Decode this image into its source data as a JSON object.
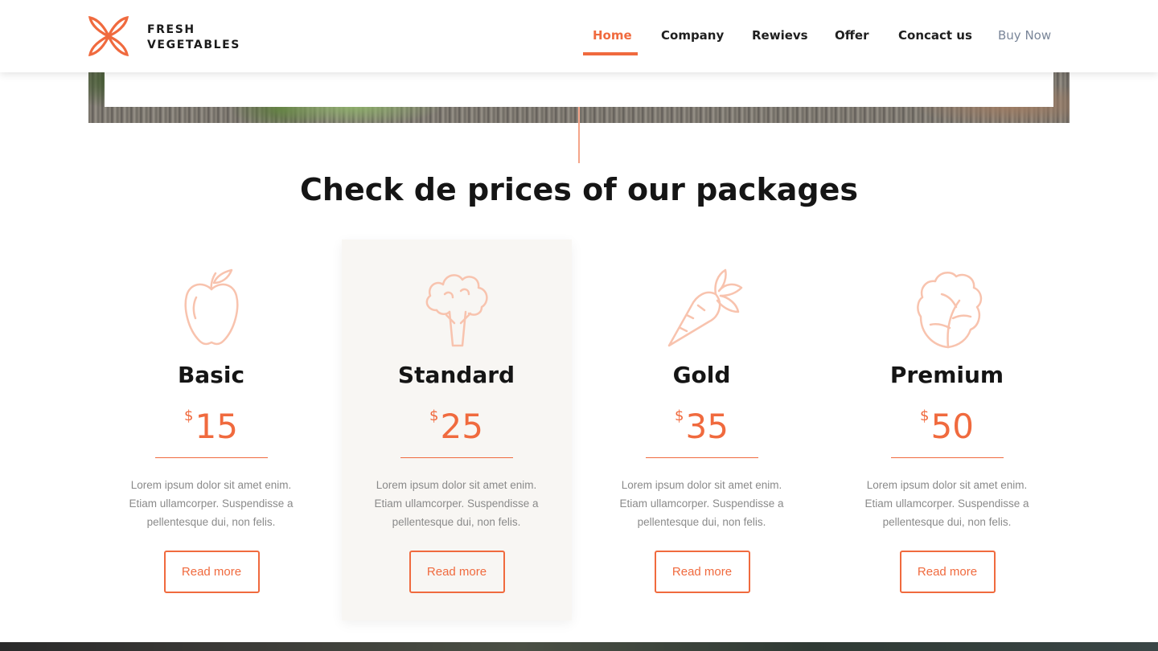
{
  "brand": {
    "line1": "FRESH",
    "line2": "VEGETABLES"
  },
  "nav": [
    {
      "label": "Home",
      "active": true
    },
    {
      "label": "Company"
    },
    {
      "label": "Rewievs"
    },
    {
      "label": "Offer"
    },
    {
      "label": "Concact us"
    },
    {
      "label": "Buy Now"
    }
  ],
  "section": {
    "title": "Check de prices of our packages"
  },
  "packages": [
    {
      "name": "Basic",
      "currency": "$",
      "price": "15",
      "icon": "apple-icon",
      "desc": "Lorem ipsum dolor sit amet enim. Etiam ullamcorper. Suspendisse a pellentesque dui, non felis.",
      "button": "Read more"
    },
    {
      "name": "Standard",
      "currency": "$",
      "price": "25",
      "icon": "broccoli-icon",
      "desc": "Lorem ipsum dolor sit amet enim. Etiam ullamcorper. Suspendisse a pellentesque dui, non felis.",
      "button": "Read more"
    },
    {
      "name": "Gold",
      "currency": "$",
      "price": "35",
      "icon": "carrot-icon",
      "desc": "Lorem ipsum dolor sit amet enim. Etiam ullamcorper. Suspendisse a pellentesque dui, non felis.",
      "button": "Read more"
    },
    {
      "name": "Premium",
      "currency": "$",
      "price": "50",
      "icon": "lettuce-icon",
      "desc": "Lorem ipsum dolor sit amet enim. Etiam ullamcorper. Suspendisse a pellentesque dui, non felis.",
      "button": "Read more"
    }
  ],
  "colors": {
    "accent": "#f06a3e",
    "icon": "#f8c3ae",
    "highlight_bg": "#f8f6f3"
  }
}
